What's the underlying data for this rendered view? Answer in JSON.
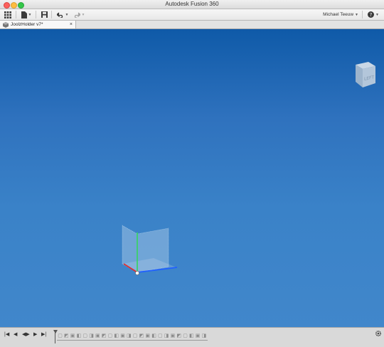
{
  "window": {
    "title": "Autodesk Fusion 360"
  },
  "toolbar": {
    "user_name": "Michael Teeuw",
    "icons": [
      "apps-grid-icon",
      "file-icon",
      "save-icon",
      "undo-icon",
      "redo-icon",
      "help-icon"
    ]
  },
  "tabs": [
    {
      "label": "JoolzHolder v7*",
      "close_glyph": "×"
    }
  ],
  "viewcube": {
    "face_label": "LEFT"
  },
  "timeline": {
    "controls": [
      "|◀",
      "◀",
      "◀▶",
      "▶",
      "▶|"
    ],
    "feature_count": 24,
    "settings_icon": "gear-icon"
  },
  "colors": {
    "canvas_top": "#0f5aa8",
    "canvas_bottom": "#4187cb",
    "axis_x": "#e03030",
    "axis_y": "#3bd16a",
    "axis_z": "#2060ff"
  }
}
